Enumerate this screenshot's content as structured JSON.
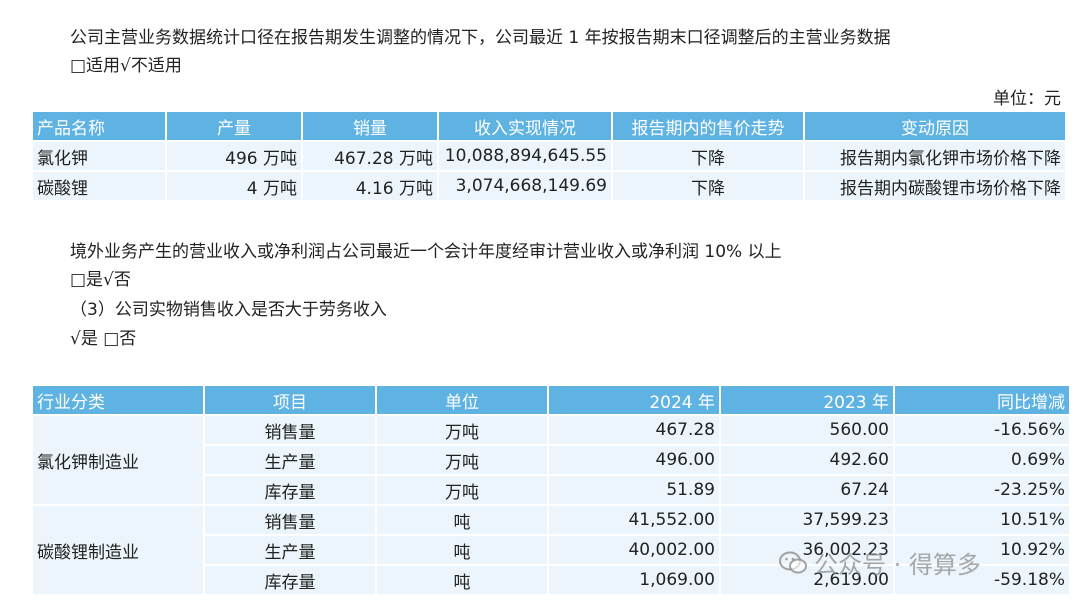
{
  "intro": {
    "line1": "公司主营业务数据统计口径在报告期发生调整的情况下，公司最近 1 年按报告期末口径调整后的主营业务数据",
    "line2": "□适用√不适用"
  },
  "unit_label": "单位：元",
  "table1": {
    "headers": [
      "产品名称",
      "产量",
      "销量",
      "收入实现情况",
      "报告期内的售价走势",
      "变动原因"
    ],
    "rows": [
      [
        "氯化钾",
        "496 万吨",
        "467.28 万吨",
        "10,088,894,645.55",
        "下降",
        "报告期内氯化钾市场价格下降"
      ],
      [
        "碳酸锂",
        "4 万吨",
        "4.16 万吨",
        "3,074,668,149.69",
        "下降",
        "报告期内碳酸锂市场价格下降"
      ]
    ]
  },
  "section2": {
    "line1": "境外业务产生的营业收入或净利润占公司最近一个会计年度经审计营业收入或净利润 10% 以上",
    "line2": "□是√否",
    "line3": "（3）公司实物销售收入是否大于劳务收入",
    "line4": "√是 □否"
  },
  "table2": {
    "headers": [
      "行业分类",
      "项目",
      "单位",
      "2024 年",
      "2023 年",
      "同比增减"
    ],
    "groups": [
      {
        "industry": "氯化钾制造业",
        "rows": [
          [
            "销售量",
            "万吨",
            "467.28",
            "560.00",
            "-16.56%"
          ],
          [
            "生产量",
            "万吨",
            "496.00",
            "492.60",
            "0.69%"
          ],
          [
            "库存量",
            "万吨",
            "51.89",
            "67.24",
            "-23.25%"
          ]
        ]
      },
      {
        "industry": "碳酸锂制造业",
        "rows": [
          [
            "销售量",
            "吨",
            "41,552.00",
            "37,599.23",
            "10.51%"
          ],
          [
            "生产量",
            "吨",
            "40,002.00",
            "36,002.23",
            "10.92%"
          ],
          [
            "库存量",
            "吨",
            "1,069.00",
            "2,619.00",
            "-59.18%"
          ]
        ]
      }
    ]
  },
  "watermark": {
    "text": "公众号 · 得算多",
    "icon": "wechat-icon"
  }
}
